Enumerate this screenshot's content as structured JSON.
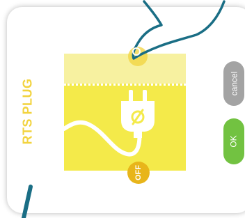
{
  "dialog": {
    "title": "RTS PLUG",
    "colors": {
      "accent_yellow": "#f2d33e",
      "zone_on": "#f7f1a0",
      "zone_off": "#f4ea4a",
      "cancel_gray": "#a3a3a3",
      "ok_green": "#72c241",
      "hand_teal": "#1a6e85"
    }
  },
  "switch": {
    "state_label": "OFF",
    "icon": "plug-off-icon"
  },
  "buttons": {
    "cancel_label": "cancel",
    "ok_label": "OK"
  }
}
